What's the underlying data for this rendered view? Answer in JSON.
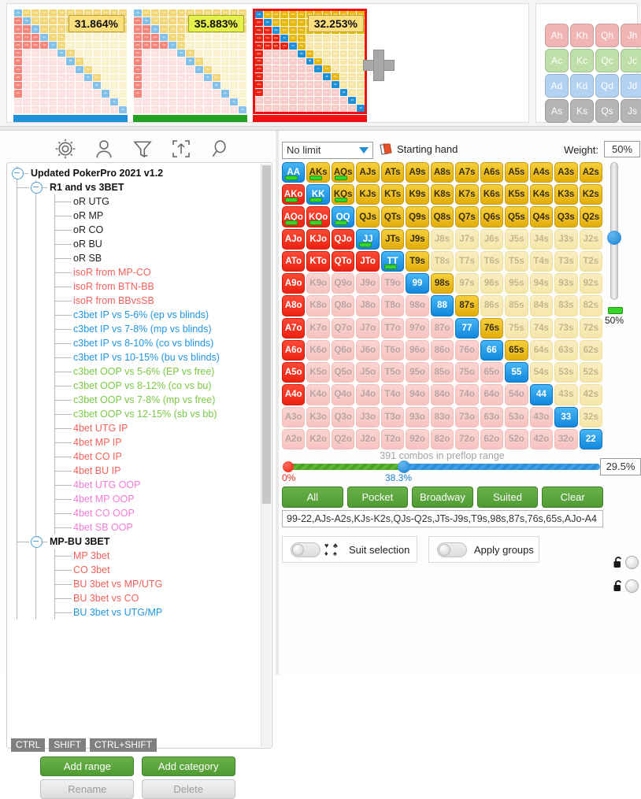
{
  "top": {
    "thumbnails": [
      {
        "percent": "31.864%",
        "bar_color": "#1f90d8",
        "badge_color": "#fbdf7d",
        "selected": false
      },
      {
        "percent": "35.883%",
        "bar_color": "#22a022",
        "badge_color": "#e6f24a",
        "selected": false
      },
      {
        "percent": "32.253%",
        "bar_color": "#ee1111",
        "badge_color": "#fbdf7d",
        "selected": true
      }
    ],
    "add_button": "plus-icon",
    "cards": [
      {
        "label": "Ah",
        "suit": "h"
      },
      {
        "label": "Kh",
        "suit": "h"
      },
      {
        "label": "Qh",
        "suit": "h"
      },
      {
        "label": "Jh",
        "suit": "h"
      },
      {
        "label": "Ac",
        "suit": "c"
      },
      {
        "label": "Kc",
        "suit": "c"
      },
      {
        "label": "Qc",
        "suit": "c"
      },
      {
        "label": "Jc",
        "suit": "c"
      },
      {
        "label": "Ad",
        "suit": "d"
      },
      {
        "label": "Kd",
        "suit": "d"
      },
      {
        "label": "Qd",
        "suit": "d"
      },
      {
        "label": "Jd",
        "suit": "d"
      },
      {
        "label": "As",
        "suit": "s"
      },
      {
        "label": "Ks",
        "suit": "s"
      },
      {
        "label": "Qs",
        "suit": "s"
      },
      {
        "label": "Js",
        "suit": "s"
      }
    ]
  },
  "left": {
    "toolbar_icons": [
      "gear-icon",
      "person-icon",
      "filter-icon",
      "export-icon",
      "search-icon"
    ],
    "tree": [
      {
        "label": "Updated PokerPro 2021 v1.2",
        "depth": 0,
        "color": "#111111",
        "bold": true,
        "toggle": true
      },
      {
        "label": "R1 and vs 3BET",
        "depth": 1,
        "color": "#111111",
        "bold": true,
        "toggle": true
      },
      {
        "label": "oR UTG",
        "depth": 2,
        "color": "#222222",
        "bold": false,
        "toggle": false
      },
      {
        "label": "oR MP",
        "depth": 2,
        "color": "#222222",
        "bold": false,
        "toggle": false
      },
      {
        "label": "oR CO",
        "depth": 2,
        "color": "#222222",
        "bold": false,
        "toggle": false
      },
      {
        "label": "oR BU",
        "depth": 2,
        "color": "#222222",
        "bold": false,
        "toggle": false
      },
      {
        "label": "oR SB",
        "depth": 2,
        "color": "#222222",
        "bold": false,
        "toggle": false
      },
      {
        "label": "isoR from MP-CO",
        "depth": 2,
        "color": "#f4605a",
        "bold": false,
        "toggle": false
      },
      {
        "label": "isoR from BTN-BB",
        "depth": 2,
        "color": "#f4605a",
        "bold": false,
        "toggle": false
      },
      {
        "label": "isoR from BBvsSB",
        "depth": 2,
        "color": "#f4605a",
        "bold": false,
        "toggle": false
      },
      {
        "label": "c3bet IP vs 5-6% (ep vs blinds)",
        "depth": 2,
        "color": "#2196e3",
        "bold": false,
        "toggle": false
      },
      {
        "label": "c3bet IP vs 7-8% (mp vs blinds)",
        "depth": 2,
        "color": "#2196e3",
        "bold": false,
        "toggle": false
      },
      {
        "label": "c3bet IP vs 8-10% (co vs blinds)",
        "depth": 2,
        "color": "#2196e3",
        "bold": false,
        "toggle": false
      },
      {
        "label": "c3bet IP vs 10-15% (bu vs blinds)",
        "depth": 2,
        "color": "#2196e3",
        "bold": false,
        "toggle": false
      },
      {
        "label": "c3bet OOP vs 5-6% (EP vs free)",
        "depth": 2,
        "color": "#7ac943",
        "bold": false,
        "toggle": false
      },
      {
        "label": "c3bet OOP vs 8-12% (co vs bu)",
        "depth": 2,
        "color": "#7ac943",
        "bold": false,
        "toggle": false
      },
      {
        "label": "c3bet OOP vs 7-8% (mp vs free)",
        "depth": 2,
        "color": "#7ac943",
        "bold": false,
        "toggle": false
      },
      {
        "label": "c3bet OOP vs 12-15% (sb vs bb)",
        "depth": 2,
        "color": "#7ac943",
        "bold": false,
        "toggle": false
      },
      {
        "label": "4bet UTG IP",
        "depth": 2,
        "color": "#f4605a",
        "bold": false,
        "toggle": false
      },
      {
        "label": "4bet MP IP",
        "depth": 2,
        "color": "#f4605a",
        "bold": false,
        "toggle": false
      },
      {
        "label": "4bet CO IP",
        "depth": 2,
        "color": "#f4605a",
        "bold": false,
        "toggle": false
      },
      {
        "label": "4bet BU IP",
        "depth": 2,
        "color": "#f4605a",
        "bold": false,
        "toggle": false
      },
      {
        "label": "4bet UTG OOP",
        "depth": 2,
        "color": "#f47ad6",
        "bold": false,
        "toggle": false
      },
      {
        "label": "4bet MP OOP",
        "depth": 2,
        "color": "#f47ad6",
        "bold": false,
        "toggle": false
      },
      {
        "label": "4bet CO OOP",
        "depth": 2,
        "color": "#f47ad6",
        "bold": false,
        "toggle": false
      },
      {
        "label": "4bet SB OOP",
        "depth": 2,
        "color": "#f47ad6",
        "bold": false,
        "toggle": false
      },
      {
        "label": "MP-BU 3BET",
        "depth": 1,
        "color": "#111111",
        "bold": true,
        "toggle": true
      },
      {
        "label": "MP 3bet",
        "depth": 2,
        "color": "#f4605a",
        "bold": false,
        "toggle": false
      },
      {
        "label": "CO 3bet",
        "depth": 2,
        "color": "#f4605a",
        "bold": false,
        "toggle": false
      },
      {
        "label": "BU 3bet vs MP/UTG",
        "depth": 2,
        "color": "#f4605a",
        "bold": false,
        "toggle": false
      },
      {
        "label": "BU 3bet vs CO",
        "depth": 2,
        "color": "#f4605a",
        "bold": false,
        "toggle": false
      },
      {
        "label": "BU 3bet vs UTG/MP",
        "depth": 2,
        "color": "#2196e3",
        "bold": false,
        "toggle": false
      }
    ],
    "key_hints": [
      "CTRL",
      "SHIFT",
      "CTRL+SHIFT"
    ],
    "buttons": {
      "add_range": "Add range",
      "add_category": "Add category",
      "rename": "Rename",
      "delete": "Delete"
    }
  },
  "right": {
    "limit_select": {
      "value": "No limit"
    },
    "starting_hand_label": "Starting hand",
    "weight_label": "Weight:",
    "weight_value": "50%",
    "combos_text": "391 combos in preflop range",
    "slider": {
      "left_label": "0%",
      "mid_label": "38.3%",
      "pct_value": "29.5%",
      "mid_position_pct": 38.3
    },
    "vertical_slider": {
      "value": "50%",
      "position_pct": 55
    },
    "quick_buttons": [
      "All",
      "Pocket",
      "Broadway",
      "Suited",
      "Clear"
    ],
    "range_string": "99-22,AJs-A2s,KJs-K2s,QJs-Q2s,JTs-J9s,T9s,98s,87s,76s,65s,AJo-A4",
    "toggles": [
      {
        "label": "Suit selection",
        "on": false,
        "icon": "suits-icon"
      },
      {
        "label": "Apply groups",
        "on": false,
        "icon": null
      }
    ],
    "locks": [
      {
        "icon": "unlock-icon",
        "on": false
      },
      {
        "icon": "unlock-icon",
        "on": false
      }
    ]
  },
  "matrix": {
    "ranks": [
      "A",
      "K",
      "Q",
      "J",
      "T",
      "9",
      "8",
      "7",
      "6",
      "5",
      "4",
      "3",
      "2"
    ],
    "cells": [
      [
        {
          "l": "AA",
          "s": "blue",
          "t": true
        },
        {
          "l": "AKs",
          "s": "gold",
          "t": true
        },
        {
          "l": "AQs",
          "s": "gold",
          "t": true
        },
        {
          "l": "AJs",
          "s": "gold"
        },
        {
          "l": "ATs",
          "s": "gold"
        },
        {
          "l": "A9s",
          "s": "gold"
        },
        {
          "l": "A8s",
          "s": "gold"
        },
        {
          "l": "A7s",
          "s": "gold"
        },
        {
          "l": "A6s",
          "s": "gold"
        },
        {
          "l": "A5s",
          "s": "gold"
        },
        {
          "l": "A4s",
          "s": "gold"
        },
        {
          "l": "A3s",
          "s": "gold"
        },
        {
          "l": "A2s",
          "s": "gold"
        }
      ],
      [
        {
          "l": "AKo",
          "s": "red",
          "t": true
        },
        {
          "l": "KK",
          "s": "blue",
          "t": true
        },
        {
          "l": "KQs",
          "s": "gold",
          "t": true
        },
        {
          "l": "KJs",
          "s": "gold"
        },
        {
          "l": "KTs",
          "s": "gold"
        },
        {
          "l": "K9s",
          "s": "gold"
        },
        {
          "l": "K8s",
          "s": "gold"
        },
        {
          "l": "K7s",
          "s": "gold"
        },
        {
          "l": "K6s",
          "s": "gold"
        },
        {
          "l": "K5s",
          "s": "gold"
        },
        {
          "l": "K4s",
          "s": "gold"
        },
        {
          "l": "K3s",
          "s": "gold"
        },
        {
          "l": "K2s",
          "s": "gold"
        }
      ],
      [
        {
          "l": "AQo",
          "s": "red",
          "t": true
        },
        {
          "l": "KQo",
          "s": "red",
          "t": true
        },
        {
          "l": "QQ",
          "s": "blue",
          "t": true
        },
        {
          "l": "QJs",
          "s": "gold"
        },
        {
          "l": "QTs",
          "s": "gold"
        },
        {
          "l": "Q9s",
          "s": "gold"
        },
        {
          "l": "Q8s",
          "s": "gold"
        },
        {
          "l": "Q7s",
          "s": "gold"
        },
        {
          "l": "Q6s",
          "s": "gold"
        },
        {
          "l": "Q5s",
          "s": "gold"
        },
        {
          "l": "Q4s",
          "s": "gold"
        },
        {
          "l": "Q3s",
          "s": "gold"
        },
        {
          "l": "Q2s",
          "s": "gold"
        }
      ],
      [
        {
          "l": "AJo",
          "s": "red"
        },
        {
          "l": "KJo",
          "s": "red"
        },
        {
          "l": "QJo",
          "s": "red"
        },
        {
          "l": "JJ",
          "s": "blue",
          "t": true
        },
        {
          "l": "JTs",
          "s": "gold"
        },
        {
          "l": "J9s",
          "s": "gold"
        },
        {
          "l": "J8s",
          "s": "palegold"
        },
        {
          "l": "J7s",
          "s": "palegold"
        },
        {
          "l": "J6s",
          "s": "palegold"
        },
        {
          "l": "J5s",
          "s": "palegold"
        },
        {
          "l": "J4s",
          "s": "palegold"
        },
        {
          "l": "J3s",
          "s": "palegold"
        },
        {
          "l": "J2s",
          "s": "palegold"
        }
      ],
      [
        {
          "l": "ATo",
          "s": "red"
        },
        {
          "l": "KTo",
          "s": "red"
        },
        {
          "l": "QTo",
          "s": "red"
        },
        {
          "l": "JTo",
          "s": "red"
        },
        {
          "l": "TT",
          "s": "blue",
          "t": true
        },
        {
          "l": "T9s",
          "s": "gold"
        },
        {
          "l": "T8s",
          "s": "palegold"
        },
        {
          "l": "T7s",
          "s": "palegold"
        },
        {
          "l": "T6s",
          "s": "palegold"
        },
        {
          "l": "T5s",
          "s": "palegold"
        },
        {
          "l": "T4s",
          "s": "palegold"
        },
        {
          "l": "T3s",
          "s": "palegold"
        },
        {
          "l": "T2s",
          "s": "palegold"
        }
      ],
      [
        {
          "l": "A9o",
          "s": "red"
        },
        {
          "l": "K9o",
          "s": "palered"
        },
        {
          "l": "Q9o",
          "s": "palered"
        },
        {
          "l": "J9o",
          "s": "palered"
        },
        {
          "l": "T9o",
          "s": "palered"
        },
        {
          "l": "99",
          "s": "blue"
        },
        {
          "l": "98s",
          "s": "gold"
        },
        {
          "l": "97s",
          "s": "palegold"
        },
        {
          "l": "96s",
          "s": "palegold"
        },
        {
          "l": "95s",
          "s": "palegold"
        },
        {
          "l": "94s",
          "s": "palegold"
        },
        {
          "l": "93s",
          "s": "palegold"
        },
        {
          "l": "92s",
          "s": "palegold"
        }
      ],
      [
        {
          "l": "A8o",
          "s": "red"
        },
        {
          "l": "K8o",
          "s": "palered"
        },
        {
          "l": "Q8o",
          "s": "palered"
        },
        {
          "l": "J8o",
          "s": "palered"
        },
        {
          "l": "T8o",
          "s": "palered"
        },
        {
          "l": "98o",
          "s": "palered"
        },
        {
          "l": "88",
          "s": "blue"
        },
        {
          "l": "87s",
          "s": "gold"
        },
        {
          "l": "86s",
          "s": "palegold"
        },
        {
          "l": "85s",
          "s": "palegold"
        },
        {
          "l": "84s",
          "s": "palegold"
        },
        {
          "l": "83s",
          "s": "palegold"
        },
        {
          "l": "82s",
          "s": "palegold"
        }
      ],
      [
        {
          "l": "A7o",
          "s": "red"
        },
        {
          "l": "K7o",
          "s": "palered"
        },
        {
          "l": "Q7o",
          "s": "palered"
        },
        {
          "l": "J7o",
          "s": "palered"
        },
        {
          "l": "T7o",
          "s": "palered"
        },
        {
          "l": "97o",
          "s": "palered"
        },
        {
          "l": "87o",
          "s": "palered"
        },
        {
          "l": "77",
          "s": "blue"
        },
        {
          "l": "76s",
          "s": "gold"
        },
        {
          "l": "75s",
          "s": "palegold"
        },
        {
          "l": "74s",
          "s": "palegold"
        },
        {
          "l": "73s",
          "s": "palegold"
        },
        {
          "l": "72s",
          "s": "palegold"
        }
      ],
      [
        {
          "l": "A6o",
          "s": "red"
        },
        {
          "l": "K6o",
          "s": "palered"
        },
        {
          "l": "Q6o",
          "s": "palered"
        },
        {
          "l": "J6o",
          "s": "palered"
        },
        {
          "l": "T6o",
          "s": "palered"
        },
        {
          "l": "96o",
          "s": "palered"
        },
        {
          "l": "86o",
          "s": "palered"
        },
        {
          "l": "76o",
          "s": "palered"
        },
        {
          "l": "66",
          "s": "blue"
        },
        {
          "l": "65s",
          "s": "gold"
        },
        {
          "l": "64s",
          "s": "palegold"
        },
        {
          "l": "63s",
          "s": "palegold"
        },
        {
          "l": "62s",
          "s": "palegold"
        }
      ],
      [
        {
          "l": "A5o",
          "s": "red"
        },
        {
          "l": "K5o",
          "s": "palered"
        },
        {
          "l": "Q5o",
          "s": "palered"
        },
        {
          "l": "J5o",
          "s": "palered"
        },
        {
          "l": "T5o",
          "s": "palered"
        },
        {
          "l": "95o",
          "s": "palered"
        },
        {
          "l": "85o",
          "s": "palered"
        },
        {
          "l": "75o",
          "s": "palered"
        },
        {
          "l": "65o",
          "s": "palered"
        },
        {
          "l": "55",
          "s": "blue"
        },
        {
          "l": "54s",
          "s": "palegold"
        },
        {
          "l": "53s",
          "s": "palegold"
        },
        {
          "l": "52s",
          "s": "palegold"
        }
      ],
      [
        {
          "l": "A4o",
          "s": "red"
        },
        {
          "l": "K4o",
          "s": "palered"
        },
        {
          "l": "Q4o",
          "s": "palered"
        },
        {
          "l": "J4o",
          "s": "palered"
        },
        {
          "l": "T4o",
          "s": "palered"
        },
        {
          "l": "94o",
          "s": "palered"
        },
        {
          "l": "84o",
          "s": "palered"
        },
        {
          "l": "74o",
          "s": "palered"
        },
        {
          "l": "64o",
          "s": "palered"
        },
        {
          "l": "54o",
          "s": "palered"
        },
        {
          "l": "44",
          "s": "blue"
        },
        {
          "l": "43s",
          "s": "palegold"
        },
        {
          "l": "42s",
          "s": "palegold"
        }
      ],
      [
        {
          "l": "A3o",
          "s": "palered"
        },
        {
          "l": "K3o",
          "s": "palered"
        },
        {
          "l": "Q3o",
          "s": "palered"
        },
        {
          "l": "J3o",
          "s": "palered"
        },
        {
          "l": "T3o",
          "s": "palered"
        },
        {
          "l": "93o",
          "s": "palered"
        },
        {
          "l": "83o",
          "s": "palered"
        },
        {
          "l": "73o",
          "s": "palered"
        },
        {
          "l": "63o",
          "s": "palered"
        },
        {
          "l": "53o",
          "s": "palered"
        },
        {
          "l": "43o",
          "s": "palered"
        },
        {
          "l": "33",
          "s": "blue"
        },
        {
          "l": "32s",
          "s": "palegold"
        }
      ],
      [
        {
          "l": "A2o",
          "s": "palered"
        },
        {
          "l": "K2o",
          "s": "palered"
        },
        {
          "l": "Q2o",
          "s": "palered"
        },
        {
          "l": "J2o",
          "s": "palered"
        },
        {
          "l": "T2o",
          "s": "palered"
        },
        {
          "l": "92o",
          "s": "palered"
        },
        {
          "l": "82o",
          "s": "palered"
        },
        {
          "l": "72o",
          "s": "palered"
        },
        {
          "l": "62o",
          "s": "palered"
        },
        {
          "l": "52o",
          "s": "palered"
        },
        {
          "l": "42o",
          "s": "palered"
        },
        {
          "l": "32o",
          "s": "palered"
        },
        {
          "l": "22",
          "s": "blue"
        }
      ]
    ]
  }
}
